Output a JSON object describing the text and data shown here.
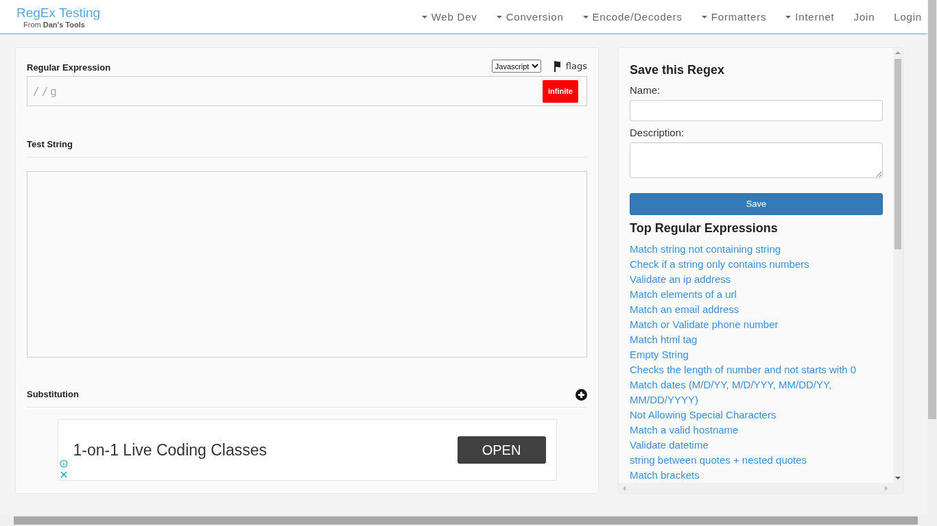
{
  "header": {
    "title": "RegEx Testing",
    "subtitle_prefix": "From",
    "subtitle_brand": "Dan's Tools",
    "nav": [
      {
        "label": "Web Dev",
        "kind": "dropdown"
      },
      {
        "label": "Conversion",
        "kind": "dropdown"
      },
      {
        "label": "Encode/Decoders",
        "kind": "dropdown"
      },
      {
        "label": "Formatters",
        "kind": "dropdown"
      },
      {
        "label": "Internet",
        "kind": "dropdown"
      },
      {
        "label": "Join",
        "kind": "link"
      },
      {
        "label": "Login",
        "kind": "link"
      }
    ]
  },
  "editor": {
    "regex_label": "Regular Expression",
    "flavor": "Javascript",
    "flags_label": "flags",
    "regex_value": "//g",
    "status_button": "infinite",
    "test_string_label": "Test String",
    "substitution_label": "Substitution",
    "ad": {
      "text": "1-on-1 Live Coding Classes",
      "button": "OPEN"
    }
  },
  "save_panel": {
    "title": "Save this Regex",
    "name_label": "Name:",
    "description_label": "Description:",
    "save_button": "Save",
    "top_title": "Top Regular Expressions",
    "top_links": [
      "Match string not containing string",
      "Check if a string only contains numbers",
      "Validate an ip address",
      "Match elements of a url",
      "Match an email address",
      "Match or Validate phone number",
      "Match html tag",
      "Empty String",
      "Checks the length of number and not starts with 0",
      "Match dates (M/D/YY, M/D/YYY, MM/DD/YY, MM/DD/YYYY)",
      "Not Allowing Special Characters",
      "Match a valid hostname",
      "Validate datetime",
      "string between quotes + nested quotes",
      "Match brackets"
    ]
  }
}
